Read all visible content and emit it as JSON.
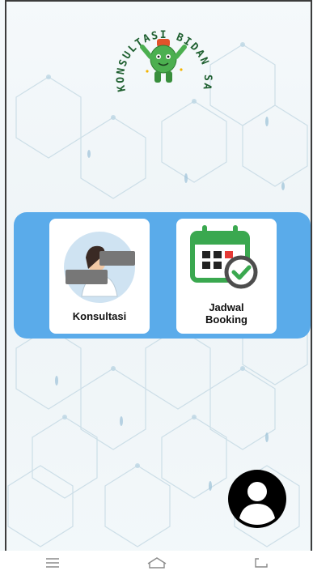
{
  "app": {
    "logo_text": "KONSULTASI BIDAN SAMBAS"
  },
  "menu": {
    "items": [
      {
        "label": "Konsultasi",
        "icon": "doctor-icon"
      },
      {
        "label_lines": [
          "Jadwal",
          "Booking"
        ],
        "icon": "calendar-check-icon"
      }
    ]
  },
  "profile": {
    "icon": "user-profile-icon"
  },
  "navbar": {
    "icons": [
      "menu-icon",
      "home-icon",
      "back-icon"
    ]
  },
  "colors": {
    "menu_panel": "#5aabea",
    "calendar_green": "#3aa84f",
    "mascot_green": "#4caf50",
    "logo_text": "#1e5f2f"
  }
}
